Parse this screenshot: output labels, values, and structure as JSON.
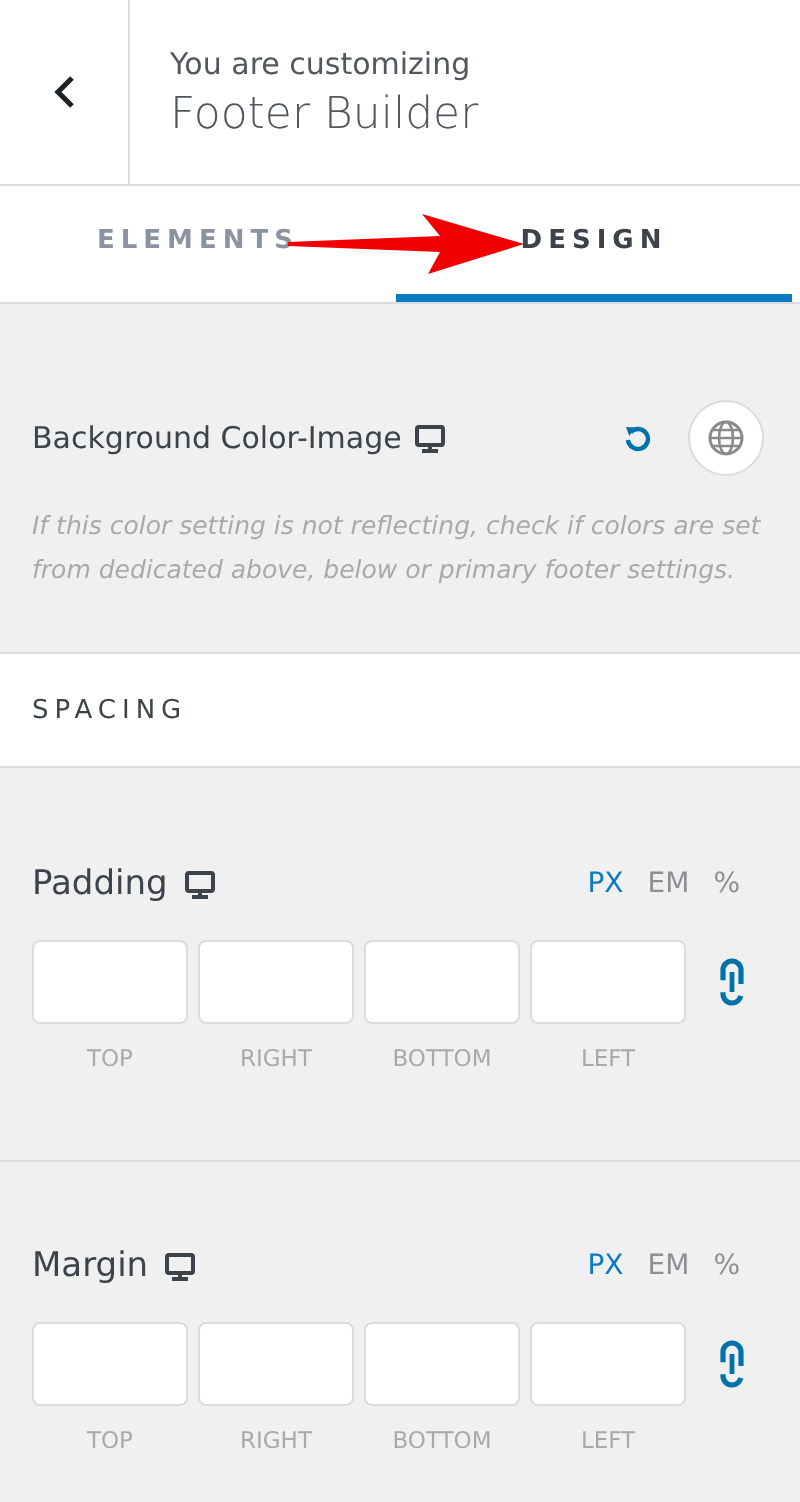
{
  "header": {
    "subtitle": "You are customizing",
    "title": "Footer Builder"
  },
  "tabs": [
    {
      "label": "ELEMENTS",
      "selected": false
    },
    {
      "label": "DESIGN",
      "selected": true
    }
  ],
  "annotation": {
    "kind": "arrow"
  },
  "background": {
    "label": "Background Color-Image",
    "help": "If this color setting is not reflecting, check if colors are set from dedicated above, below or primary footer settings."
  },
  "section": {
    "title": "SPACING"
  },
  "spacing": [
    {
      "label": "Padding",
      "units": [
        {
          "label": "PX",
          "selected": true
        },
        {
          "label": "EM",
          "selected": false
        },
        {
          "label": "%",
          "selected": false
        }
      ],
      "sides": [
        "TOP",
        "RIGHT",
        "BOTTOM",
        "LEFT"
      ],
      "linked": true
    },
    {
      "label": "Margin",
      "units": [
        {
          "label": "PX",
          "selected": true
        },
        {
          "label": "EM",
          "selected": false
        },
        {
          "label": "%",
          "selected": false
        }
      ],
      "sides": [
        "TOP",
        "RIGHT",
        "BOTTOM",
        "LEFT"
      ],
      "linked": true
    }
  ]
}
